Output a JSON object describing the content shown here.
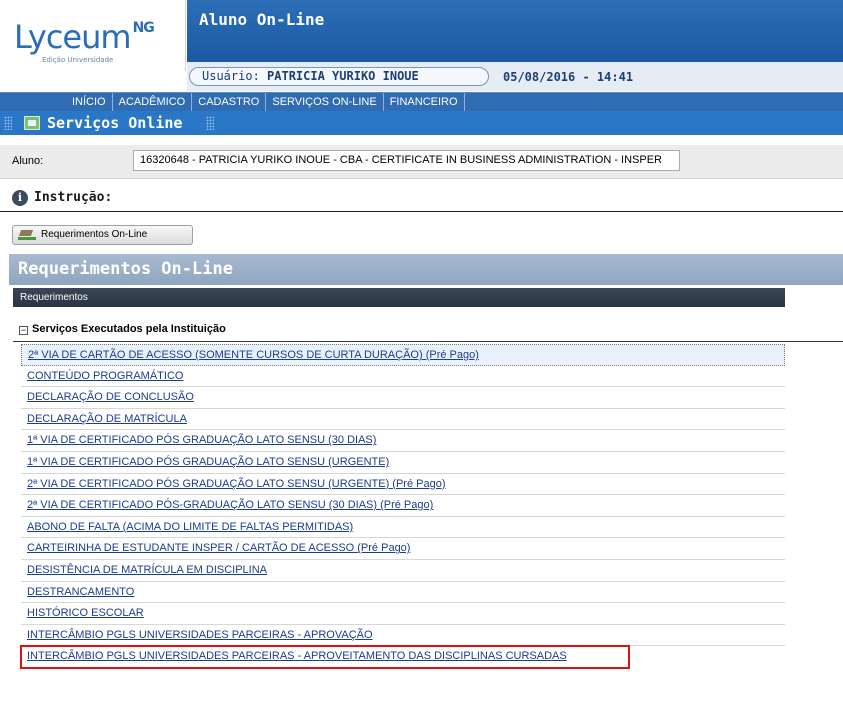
{
  "header": {
    "logo": "Lyceum",
    "logo_sup": "NG",
    "logo_sub": "Edição Universidade",
    "app_title": "Aluno On-Line",
    "user_label": "Usuário:",
    "user_name": "PATRICIA YURIKO INOUE",
    "datetime": "05/08/2016 - 14:41"
  },
  "nav": {
    "items": [
      "INÍCIO",
      "ACADÊMICO",
      "CADASTRO",
      "SERVIÇOS ON-LINE",
      "FINANCEIRO"
    ]
  },
  "section": {
    "title": "Serviços Online"
  },
  "aluno": {
    "label": "Aluno:",
    "value": "16320648 - PATRICIA YURIKO INOUE - CBA - CERTIFICATE IN BUSINESS ADMINISTRATION - INSPER"
  },
  "instrucao": {
    "title": "Instrução:"
  },
  "req_button": {
    "label": "Requerimentos On-Line"
  },
  "requerimentos": {
    "title": "Requerimentos On-Line",
    "table_header": "Requerimentos",
    "group_toggle": "−",
    "group_title": "Serviços Executados pela Instituição",
    "items": [
      "2ª VIA DE CARTÃO DE ACESSO (SOMENTE CURSOS DE CURTA DURAÇÃO) (Pré Pago)",
      "CONTEÚDO PROGRAMÁTICO",
      "DECLARAÇÃO DE CONCLUSÃO",
      "DECLARAÇÃO DE MATRÍCULA",
      "1ª VIA DE CERTIFICADO PÓS GRADUAÇÃO LATO SENSU (30 DIAS)",
      "1ª VIA DE CERTIFICADO PÓS GRADUAÇÃO LATO SENSU (URGENTE)",
      "2ª VIA DE CERTIFICADO PÓS GRADUAÇÃO LATO SENSU (URGENTE) (Pré Pago)",
      "2ª VIA DE CERTIFICADO PÓS-GRADUAÇÃO LATO SENSU (30 DIAS) (Pré Pago)",
      "ABONO DE FALTA (ACIMA DO LIMITE DE FALTAS PERMITIDAS)",
      "CARTEIRINHA DE ESTUDANTE INSPER / CARTÃO DE ACESSO (Pré Pago)",
      "DESISTÊNCIA DE MATRÍCULA EM DISCIPLINA",
      "DESTRANCAMENTO",
      "HISTÓRICO ESCOLAR",
      "INTERCÂMBIO PGLS UNIVERSIDADES PARCEIRAS - APROVAÇÃO",
      "INTERCÂMBIO PGLS UNIVERSIDADES PARCEIRAS - APROVEITAMENTO DAS DISCIPLINAS CURSADAS"
    ],
    "highlight_color": "#e01010"
  }
}
